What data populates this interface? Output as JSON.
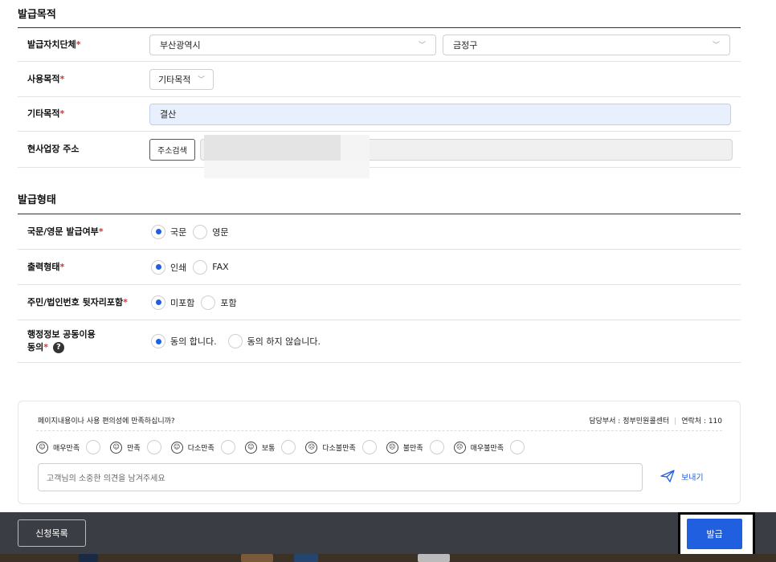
{
  "section1": {
    "title": "발급목적",
    "authority": {
      "label": "발급자치단체",
      "city": "부산광역시",
      "district": "금정구"
    },
    "purpose": {
      "label": "사용목적",
      "value": "기타목적"
    },
    "other_purpose": {
      "label": "기타목적",
      "value": "결산"
    },
    "address": {
      "label": "현사업장 주소",
      "button": "주소검색"
    }
  },
  "section2": {
    "title": "발급형태",
    "language": {
      "label": "국문/영문 발급여부",
      "options": [
        "국문",
        "영문"
      ],
      "selected": "국문"
    },
    "output": {
      "label": "출력형태",
      "options": [
        "인쇄",
        "FAX"
      ],
      "selected": "인쇄"
    },
    "id_suffix": {
      "label": "주민/법인번호 뒷자리포함",
      "options": [
        "미포함",
        "포함"
      ],
      "selected": "미포함"
    },
    "consent": {
      "label_line1": "행정정보 공동이용",
      "label_line2": "동의",
      "help": "?",
      "options": [
        "동의 합니다.",
        "동의 하지 않습니다."
      ],
      "selected": "동의 합니다."
    }
  },
  "required_mark": "*",
  "survey": {
    "question": "페이지내용이나 사용 편의성에 만족하십니까?",
    "department": "담당부서 : 정부민원콜센터",
    "contact": "연락처 : 110",
    "ratings": [
      "매우만족",
      "만족",
      "다소만족",
      "보통",
      "다소불만족",
      "불만족",
      "매우불만족"
    ],
    "comment_placeholder": "고객님의 소중한 의견을 남겨주세요",
    "send_label": "보내기"
  },
  "footer": {
    "list_button": "신청목록",
    "issue_button": "발급"
  },
  "colors": {
    "accent": "#1f5fe0",
    "required": "#e0312f",
    "footer_bg": "#3a3d44"
  }
}
